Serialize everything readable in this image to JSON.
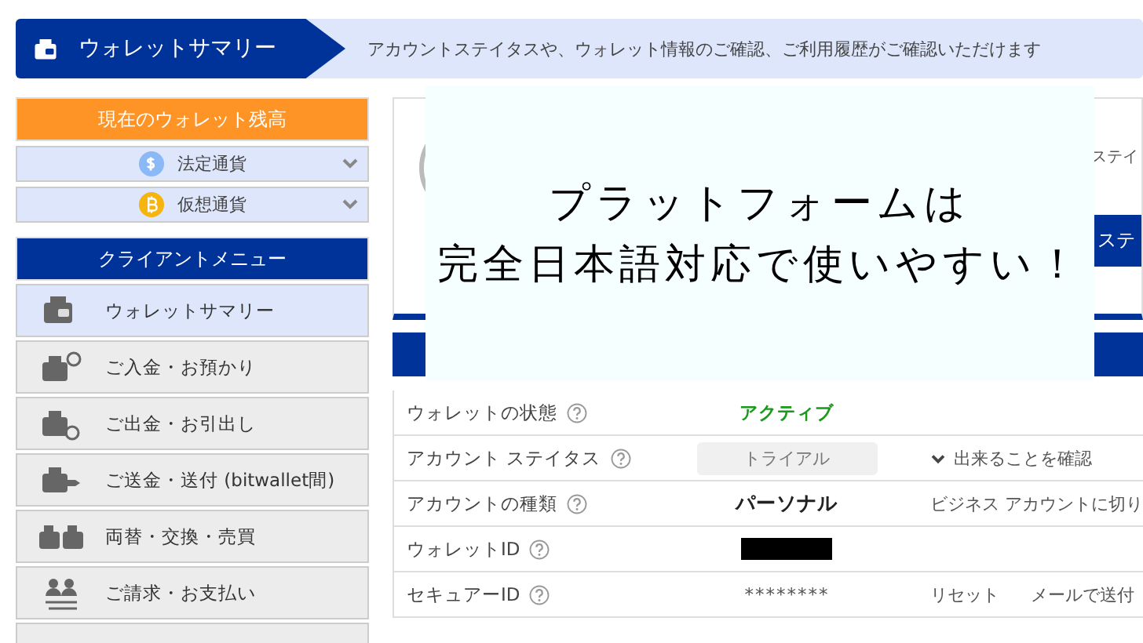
{
  "header": {
    "title": "ウォレットサマリー",
    "description": "アカウントステイタスや、ウォレット情報のご確認、ご利用履歴がご確認いただけます"
  },
  "sidebar": {
    "balance_title": "現在のウォレット残高",
    "currencies": [
      {
        "label": "法定通貨",
        "kind": "fiat",
        "expanded": false
      },
      {
        "label": "仮想通貨",
        "kind": "crypto",
        "expanded": false
      }
    ],
    "menu_title": "クライアントメニュー",
    "menu_items": [
      {
        "label": "ウォレットサマリー",
        "kind": "wallet",
        "selected": true
      },
      {
        "label": "ご入金・お預かり",
        "kind": "deposit",
        "selected": false
      },
      {
        "label": "ご出金・お引出し",
        "kind": "withdraw",
        "selected": false
      },
      {
        "label": "ご送金・送付 (bitwallet間)",
        "kind": "send",
        "selected": false
      },
      {
        "label": "両替・交換・売買",
        "kind": "exchange",
        "selected": false
      },
      {
        "label": "ご請求・お支払い",
        "kind": "billing",
        "selected": false
      }
    ]
  },
  "profile_card": {
    "text": "ステイ",
    "button": "ステ"
  },
  "details": [
    {
      "label": "ウォレットの状態",
      "value": "アクティブ",
      "kind": "status"
    },
    {
      "label": "アカウント ステイタス",
      "value": "トライアル",
      "kind": "badge",
      "actions": [
        {
          "label": "出来ることを確認",
          "kind": "toggle"
        }
      ]
    },
    {
      "label": "アカウントの種類",
      "value": "パーソナル",
      "kind": "bold",
      "actions": [
        {
          "label": "ビジネス アカウントに切り",
          "kind": "link"
        }
      ]
    },
    {
      "label": "ウォレットID",
      "kind": "redacted"
    },
    {
      "label": "セキュアーID",
      "value": "********",
      "kind": "plain",
      "actions": [
        {
          "label": "リセット",
          "kind": "link"
        },
        {
          "label": "メールで送付",
          "kind": "link"
        }
      ]
    }
  ],
  "overlay": {
    "lines": [
      "プラットフォームは",
      "完全日本語対応で使いやすい！"
    ]
  }
}
